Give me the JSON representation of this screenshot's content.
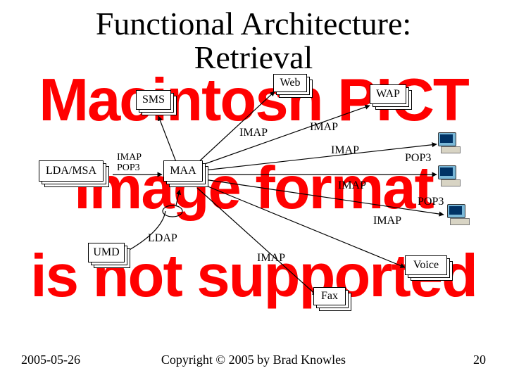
{
  "title_line1": "Functional Architecture:",
  "title_line2": "Retrieval",
  "watermark": {
    "l1": "Macintosh PICT",
    "l2": "image format",
    "l3": "is not supported"
  },
  "nodes": {
    "sms": "SMS",
    "web": "Web",
    "wap": "WAP",
    "lda_msa": "LDA/MSA",
    "maa": "MAA",
    "umd": "UMD",
    "fax": "Fax",
    "voice": "Voice"
  },
  "edges": {
    "imap_pop3_ldamsa": "IMAP\nPOP3",
    "imap_a": "IMAP",
    "imap_b": "IMAP",
    "imap_c": "IMAP",
    "imap_d": "IMAP",
    "imap_e": "IMAP",
    "imap_f": "IMAP",
    "pop3_a": "POP3",
    "pop3_b": "POP3",
    "ldap": "LDAP"
  },
  "footer": {
    "date": "2005-05-26",
    "copyright": "Copyright © 2005 by Brad Knowles",
    "page": "20"
  }
}
